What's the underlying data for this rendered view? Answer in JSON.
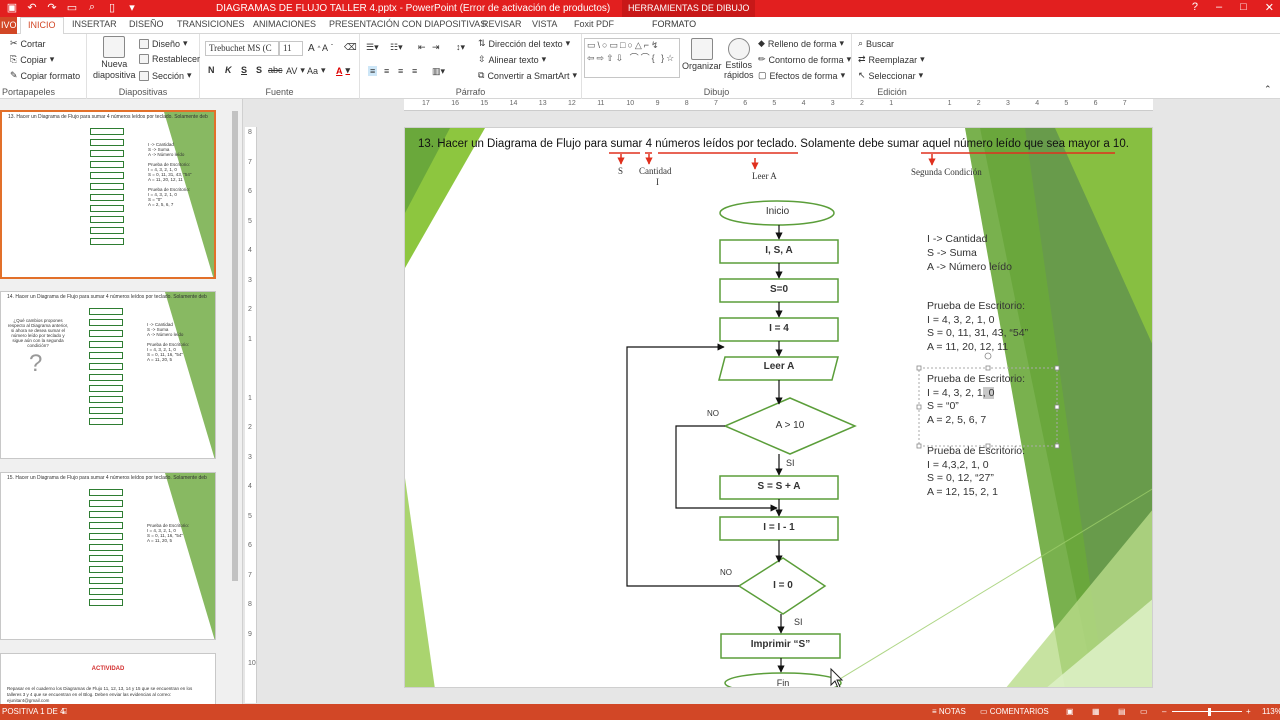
{
  "window": {
    "document_title": "DIAGRAMAS DE FLUJO TALLER 4.pptx - PowerPoint (Error de activación de productos)",
    "context_tab_title": "HERRAMIENTAS DE DIBUJO",
    "controls": [
      "?",
      "–",
      "□",
      "✕"
    ]
  },
  "tabs": {
    "file": "IVO",
    "items": [
      "INICIO",
      "INSERTAR",
      "DISEÑO",
      "TRANSICIONES",
      "ANIMACIONES",
      "PRESENTACIÓN CON DIAPOSITIVAS",
      "REVISAR",
      "VISTA",
      "Foxit PDF",
      "FORMATO"
    ]
  },
  "ribbon": {
    "clipboard": {
      "cut": "Cortar",
      "copy": "Copiar",
      "format_painter": "Copiar formato",
      "label": "Portapapeles"
    },
    "slides": {
      "new_slide_line1": "Nueva",
      "new_slide_line2": "diapositiva",
      "layout": "Diseño",
      "reset": "Restablecer",
      "section": "Sección",
      "label": "Diapositivas"
    },
    "font": {
      "name": "Trebuchet MS (C",
      "size": "11",
      "bold": "N",
      "italic": "K",
      "underline": "S",
      "shadow": "S",
      "strike": "abc",
      "spacing": "AV",
      "case": "Aa",
      "color": "A",
      "label": "Fuente"
    },
    "paragraph": {
      "text_direction": "Dirección del texto",
      "align_text": "Alinear texto",
      "smartart": "Convertir a SmartArt",
      "label": "Párrafo"
    },
    "drawing": {
      "arrange": "Organizar",
      "styles_line1": "Estilos",
      "styles_line2": "rápidos",
      "fill": "Relleno de forma",
      "outline": "Contorno de forma",
      "effects": "Efectos de forma",
      "label": "Dibujo",
      "shapes_gallery": "▭\\○▭□○△⌐↯ ⇦⇨⇧⇩ ⌒⌒{ }☆"
    },
    "editing": {
      "find": "Buscar",
      "replace": "Reemplazar",
      "select": "Seleccionar",
      "label": "Edición"
    }
  },
  "thumbnails": [
    {
      "title": "13. Hacer un Diagrama de Flujo para sumar 4 números leídos por teclado. Solamente debe sumar aquel número leído que sea mayor a 10.",
      "notes": "I -> Cantidad\nS -> Suma\nA -> Número leído\n\nPrueba de Escritorio:\nI = 4, 3, 2, 1, 0\nS = 0, 11, 31, 43, \"54\"\nA = 11, 20, 12, 11\n\nPrueba de Escritorio:\nI = 4, 3, 2, 1, 0\nS = \"0\"\nA = 2, 5, 6, 7"
    },
    {
      "title": "14. Hacer un Diagrama de Flujo para sumar 4 números leídos por teclado. Solamente debe sumar aquel número leído que sea mayor a 10.",
      "question": "¿Qué cambios propones respecto al Diagrama anterior, si ahora se desea sumar el número leído por teclado y sigue aún con la segunda condición?",
      "notes": "I -> Cantidad\nS -> Suma\nA -> Número leído\n\nPrueba de Escritorio:\nI = 4, 3, 2, 1, 0\nS = 0, 11, 16, \"54\"\nA = 11, 20, 5"
    },
    {
      "title": "15. Hacer un Diagrama de Flujo para sumar 4 números leídos por teclado. Solamente debe sumar aquel número leído que sea mayor a 20.",
      "notes": "Prueba de Escritorio:\nI = 4, 3, 2, 1, 0\nS = 0, 11, 16, \"54\"\nA = 11, 20, 5"
    },
    {
      "activity_title": "ACTIVIDAD",
      "activity_text": "Repasar en el cuaderno los Diagramas de Flujo 11, 12, 13, 14 y 15 que se encuentran en los talleres 3 y 4 que se encuentran en el Blog. Deben enviar las evidencias al correo: ejunitar4@gmail.com"
    }
  ],
  "ruler": {
    "h": [
      "17",
      "16",
      "15",
      "14",
      "13",
      "12",
      "11",
      "10",
      "9",
      "8",
      "7",
      "6",
      "5",
      "4",
      "3",
      "2",
      "1",
      "",
      "1",
      "2",
      "3",
      "4",
      "5",
      "6",
      "7"
    ],
    "v": [
      "8",
      "7",
      "6",
      "5",
      "4",
      "3",
      "2",
      "1",
      "",
      "1",
      "2",
      "3",
      "4",
      "5",
      "6",
      "7",
      "8",
      "9",
      "10"
    ]
  },
  "slide": {
    "heading": {
      "number": "13.",
      "p1": "Hacer un Diagrama de Flujo para ",
      "w_sumar": "sumar",
      "p2": " ",
      "w_4": "4",
      "p3": " ",
      "w_numeros": "números leídos por teclado",
      "p4": ". Solamente debe sumar ",
      "w_aquel": "aquel número leído que sea mayor a 10",
      "p5": "."
    },
    "annotations": {
      "s": "S",
      "cantidad": "Cantidad",
      "i": "I",
      "leer": "Leer A",
      "segunda": "Segunda Condición"
    },
    "flow": {
      "start": "Inicio",
      "declare": "I, S, A",
      "init_s": "S=0",
      "init_i": "I = 4",
      "read": "Leer A",
      "cond1": "A > 10",
      "no1": "NO",
      "si1": "SI",
      "sum": "S = S + A",
      "dec": "I = I - 1",
      "cond2": "I = 0",
      "no2": "NO",
      "si2": "SI",
      "print": "Imprimir “S”",
      "end": "Fin"
    },
    "legend": [
      "I -> Cantidad",
      "S -> Suma",
      "A -> Número leído"
    ],
    "test1": {
      "title": "Prueba de Escritorio:",
      "lines": [
        "I = 4, 3, 2, 1, 0",
        "S = 0, 11, 31, 43, “54”",
        "A = 11, 20, 12, 11"
      ]
    },
    "test2": {
      "title": "Prueba de Escritorio:",
      "i_prefix": "I = 4, 3, 2, 1",
      "i_hl": ", 0",
      "lines": [
        "S = “0”",
        "A = 2, 5, 6, 7"
      ]
    },
    "test3": {
      "title": "Prueba de Escritorio:",
      "lines": [
        "I = 4,3,2, 1, 0",
        "S = 0, 12, “27”",
        "A = 12, 15, 2, 1"
      ]
    }
  },
  "status": {
    "slide_info": "POSITIVA 1 DE 4",
    "notes": "NOTAS",
    "comments": "COMENTARIOS",
    "zoom": "113%"
  },
  "colors": {
    "accent": "#d24726",
    "title_bar": "#e21f1f",
    "green_dark": "#4e8a2c",
    "green_light": "#8dc63f",
    "flow_line": "#5b9e3a",
    "annotation_red": "#e0301e"
  }
}
